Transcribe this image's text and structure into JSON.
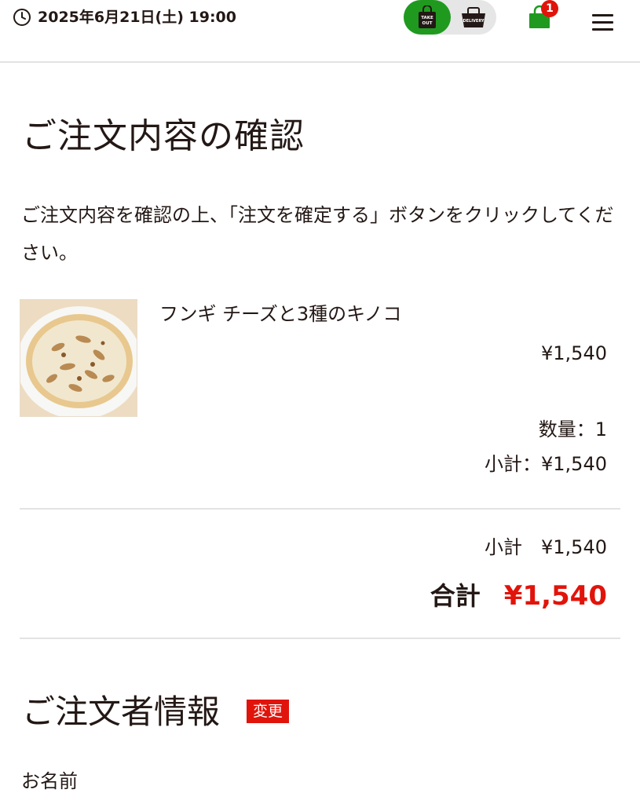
{
  "header": {
    "datetime": "2025年6月21日(土) 19:00",
    "mode_takeout_label": "TAKE OUT",
    "mode_delivery_label": "DELIVERY",
    "cart_count": "1",
    "icons": {
      "clock": "clock-icon",
      "takeout": "shopping-bag-icon",
      "delivery": "basket-icon",
      "cart": "cart-bag-icon",
      "menu": "hamburger-menu-icon"
    },
    "colors": {
      "active_mode": "#1f9a1f",
      "cart": "#1f9a1f",
      "badge": "#e1140b"
    }
  },
  "main": {
    "title": "ご注文内容の確認",
    "instruction": "ご注文内容を確認の上、「注文を確定する」ボタンをクリックしてください。",
    "items": [
      {
        "name": "フンギ チーズと3種のキノコ",
        "price": "¥1,540",
        "quantity": "数量：1",
        "subtotal": "小計：¥1,540"
      }
    ],
    "summary": {
      "subtotal_label": "小計",
      "subtotal_value": "¥1,540",
      "total_label": "合計",
      "total_value": "¥1,540",
      "total_color": "#e1140b"
    },
    "customer_section": {
      "title": "ご注文者情報",
      "change_label": "変更",
      "name_label": "お名前"
    }
  }
}
